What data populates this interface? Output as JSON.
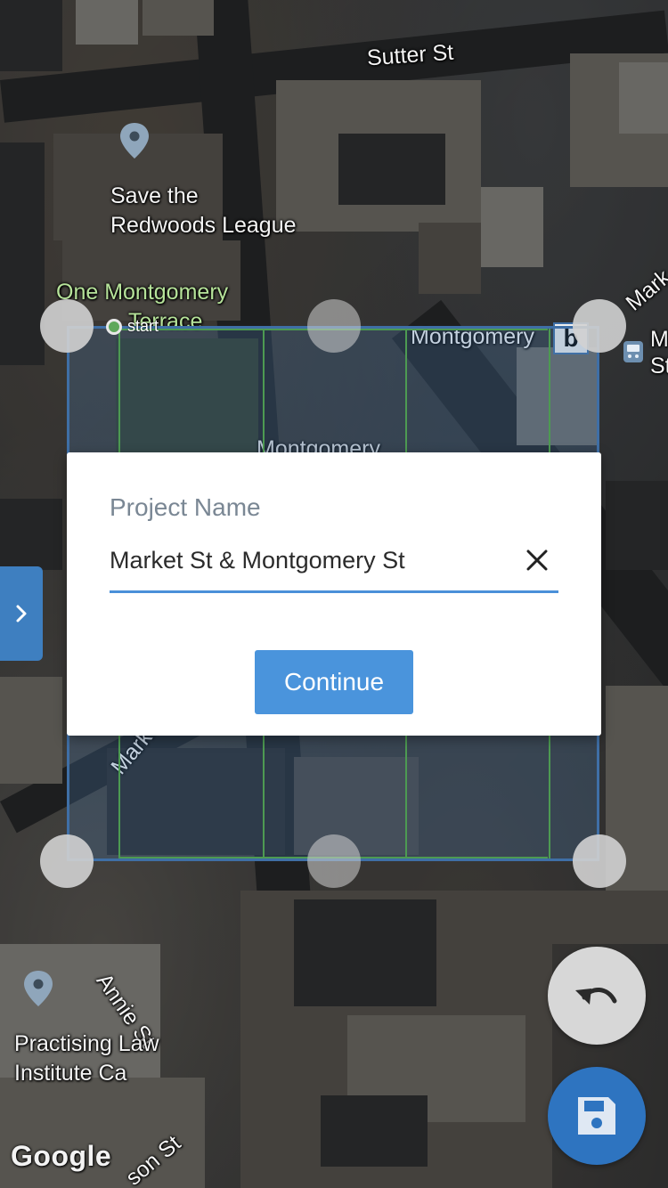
{
  "map": {
    "labels": {
      "sutter_st": "Sutter St",
      "save_redwoods_1": "Save the",
      "save_redwoods_2": "Redwoods League",
      "one_montgomery_1": "One Montgomery",
      "one_montgomery_2": "Terrace",
      "montgomery": "Montgomery",
      "montgomery_partial": "Montgomery",
      "market_partial": "Mark",
      "market_st": "Market St",
      "annie_st": "Annie St",
      "practising_1": "Practising Law",
      "practising_2": "Institute Ca",
      "bottom_st": "son St"
    },
    "start_label": "start",
    "attribution": "Google"
  },
  "dialog": {
    "label": "Project Name",
    "input_value": "Market St & Montgomery St",
    "input_placeholder": "",
    "continue_label": "Continue"
  },
  "icons": {
    "clear": "close-icon",
    "side_tab": "chevron-right-icon",
    "undo": "undo-icon",
    "save": "floppy-disk-icon",
    "pin": "map-pin-icon",
    "transit": "transit-icon"
  },
  "colors": {
    "accent": "#4a94dc",
    "save_fab": "#2e74c0",
    "selection_border": "#3f6fa6",
    "grid": "#4d9a52"
  }
}
